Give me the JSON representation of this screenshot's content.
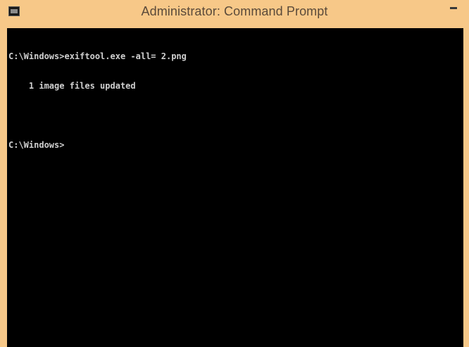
{
  "window": {
    "title": "Administrator: Command Prompt",
    "icon": "cmd-icon",
    "minimize_icon": "minimize-icon"
  },
  "console": {
    "lines": [
      "C:\\Windows>exiftool.exe -all= 2.png",
      "    1 image files updated",
      "",
      "C:\\Windows>"
    ]
  },
  "colors": {
    "titlebar": "#f7c888",
    "console_background": "#000000",
    "console_text": "#d0d0d0"
  }
}
